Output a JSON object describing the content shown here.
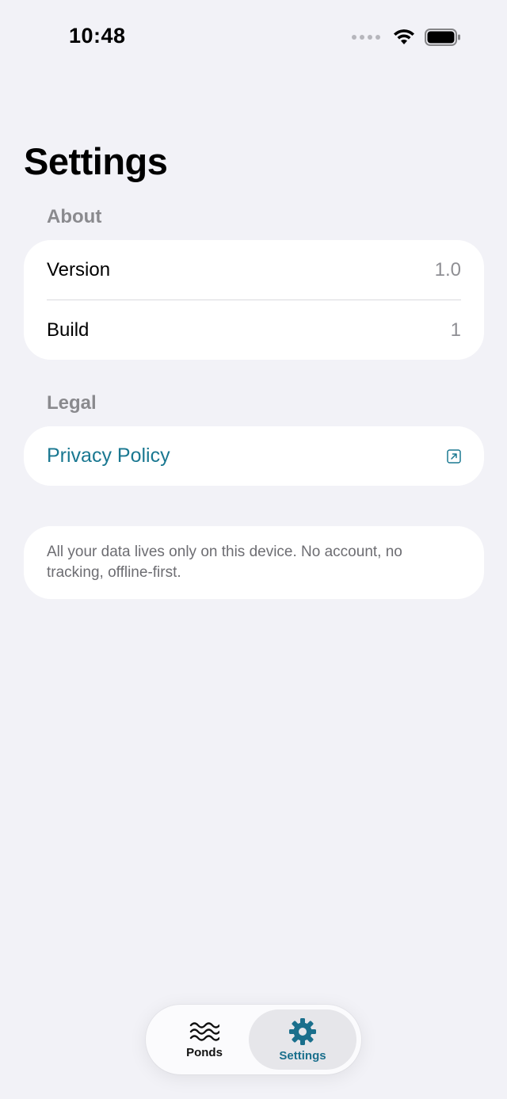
{
  "status_bar": {
    "time": "10:48"
  },
  "page": {
    "title": "Settings"
  },
  "sections": {
    "about": {
      "header": "About",
      "rows": [
        {
          "label": "Version",
          "value": "1.0"
        },
        {
          "label": "Build",
          "value": "1"
        }
      ]
    },
    "legal": {
      "header": "Legal",
      "privacy_label": "Privacy Policy",
      "privacy_icon": "external-link-icon"
    },
    "note": {
      "text": "All your data lives only on this device. No account, no tracking, offline-first."
    }
  },
  "tab_bar": {
    "tabs": [
      {
        "label": "Ponds",
        "icon": "waves-icon",
        "selected": false
      },
      {
        "label": "Settings",
        "icon": "gear-icon",
        "selected": true
      }
    ]
  },
  "colors": {
    "background": "#f2f2f7",
    "card": "#ffffff",
    "accent": "#1a7891",
    "secondary_text": "#8e8e93"
  }
}
